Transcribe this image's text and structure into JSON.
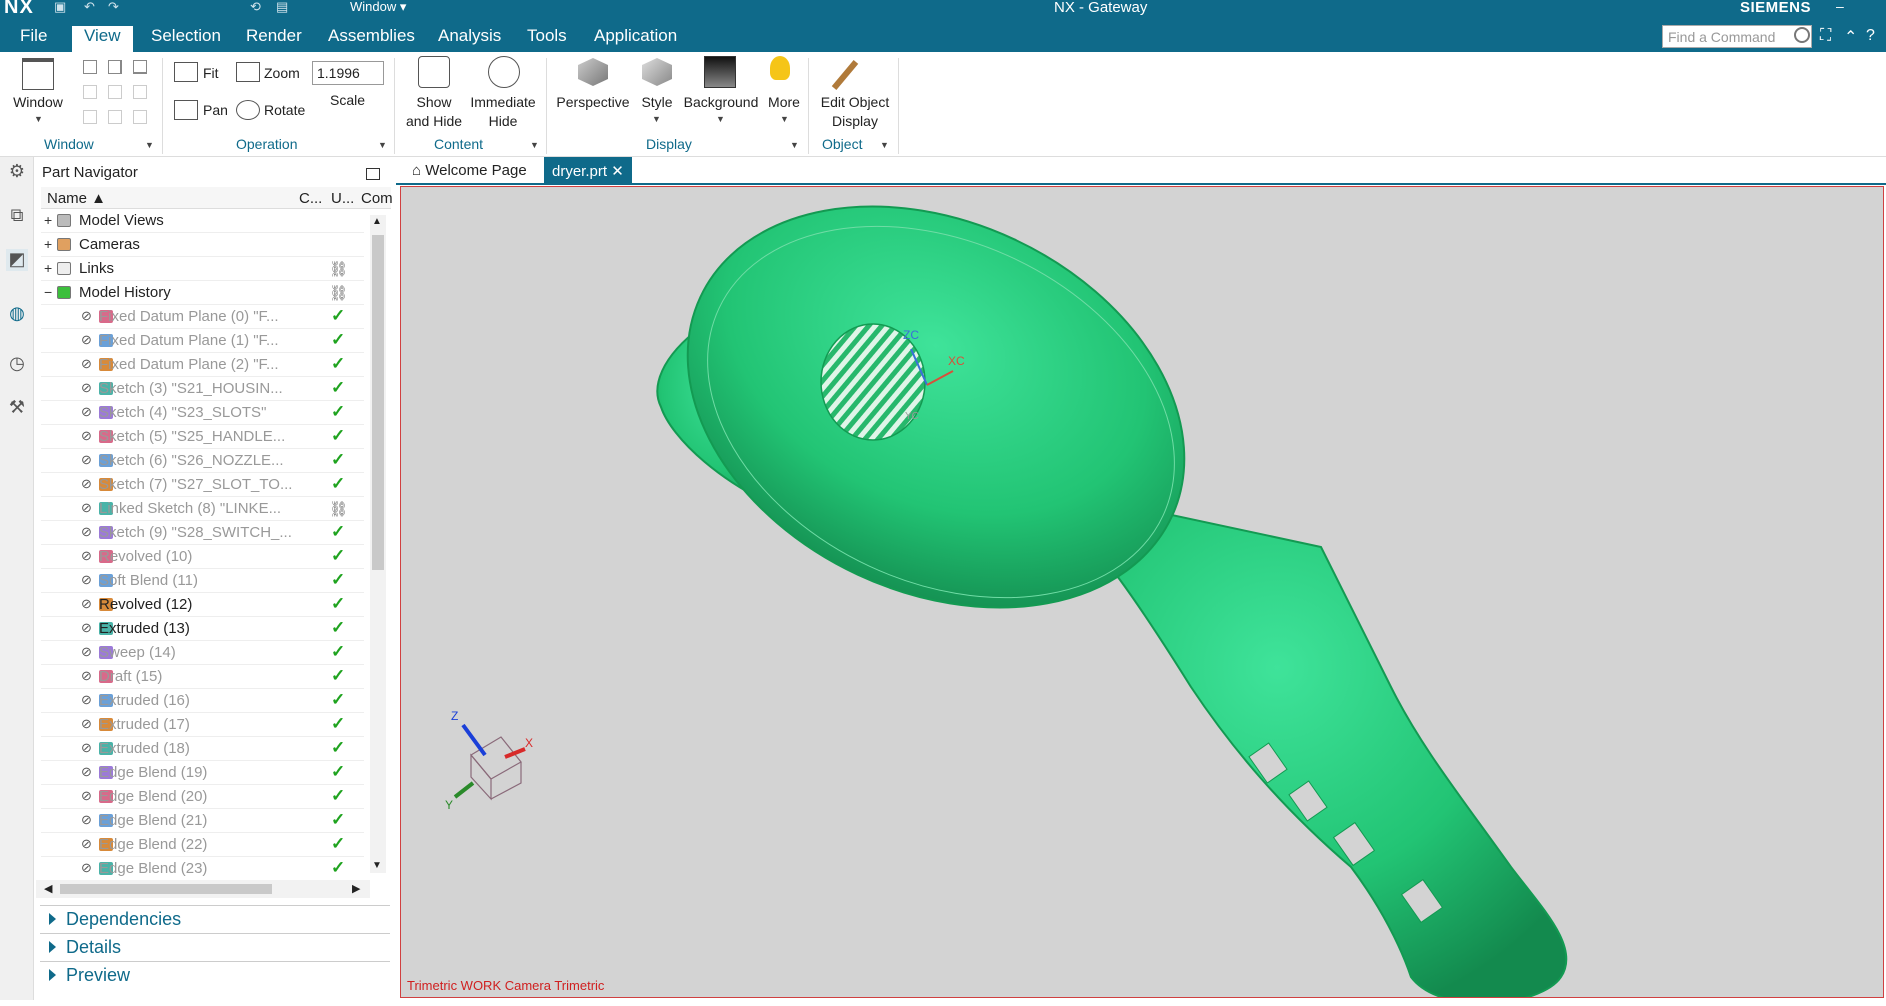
{
  "titlebar": {
    "logo": "NX",
    "window_menu": "Window",
    "title": "NX - Gateway",
    "brand": "SIEMENS"
  },
  "menubar": {
    "items": [
      "File",
      "View",
      "Selection",
      "Render",
      "Assemblies",
      "Analysis",
      "Tools",
      "Application"
    ],
    "active": "View",
    "search_placeholder": "Find a Command"
  },
  "ribbon": {
    "window_group": {
      "button": "Window",
      "label": "Window"
    },
    "operation_group": {
      "fit": "Fit",
      "zoom": "Zoom",
      "pan": "Pan",
      "rotate": "Rotate",
      "scale_value": "1.1996",
      "scale_label": "Scale",
      "label": "Operation"
    },
    "content_group": {
      "show_hide_1": "Show",
      "show_hide_2": "and Hide",
      "immediate_hide_1": "Immediate",
      "immediate_hide_2": "Hide",
      "label": "Content"
    },
    "display_group": {
      "perspective": "Perspective",
      "style": "Style",
      "background": "Background",
      "more": "More",
      "label": "Display"
    },
    "object_group": {
      "edit_1": "Edit Object",
      "edit_2": "Display",
      "label": "Object"
    }
  },
  "navigator": {
    "title": "Part Navigator",
    "columns": {
      "name": "Name",
      "c": "C...",
      "u": "U...",
      "com": "Com"
    },
    "rows": [
      {
        "label": "Model Views",
        "indent": 0,
        "dim": false,
        "status": "",
        "expand": "+"
      },
      {
        "label": "Cameras",
        "indent": 0,
        "dim": false,
        "status": "",
        "expand": "+"
      },
      {
        "label": "Links",
        "indent": 0,
        "dim": false,
        "status": "link",
        "expand": "+"
      },
      {
        "label": "Model History",
        "indent": 0,
        "dim": false,
        "status": "link",
        "expand": "−"
      },
      {
        "label": "Fixed Datum Plane (0) \"F...",
        "indent": 1,
        "dim": true,
        "status": "check"
      },
      {
        "label": "Fixed Datum Plane (1) \"F...",
        "indent": 1,
        "dim": true,
        "status": "check"
      },
      {
        "label": "Fixed Datum Plane (2) \"F...",
        "indent": 1,
        "dim": true,
        "status": "check"
      },
      {
        "label": "Sketch (3) \"S21_HOUSIN...",
        "indent": 1,
        "dim": true,
        "status": "check"
      },
      {
        "label": "Sketch (4) \"S23_SLOTS\"",
        "indent": 1,
        "dim": true,
        "status": "check"
      },
      {
        "label": "Sketch (5) \"S25_HANDLE...",
        "indent": 1,
        "dim": true,
        "status": "check"
      },
      {
        "label": "Sketch (6) \"S26_NOZZLE...",
        "indent": 1,
        "dim": true,
        "status": "check"
      },
      {
        "label": "Sketch (7) \"S27_SLOT_TO...",
        "indent": 1,
        "dim": true,
        "status": "check"
      },
      {
        "label": "Linked Sketch (8) \"LINKE...",
        "indent": 1,
        "dim": true,
        "status": "link"
      },
      {
        "label": "Sketch (9) \"S28_SWITCH_...",
        "indent": 1,
        "dim": true,
        "status": "check"
      },
      {
        "label": "Revolved (10)",
        "indent": 1,
        "dim": true,
        "status": "check"
      },
      {
        "label": "Soft Blend (11)",
        "indent": 1,
        "dim": true,
        "status": "check"
      },
      {
        "label": "Revolved (12)",
        "indent": 1,
        "dim": false,
        "status": "check"
      },
      {
        "label": "Extruded (13)",
        "indent": 1,
        "dim": false,
        "status": "check"
      },
      {
        "label": "Sweep (14)",
        "indent": 1,
        "dim": true,
        "status": "check"
      },
      {
        "label": "Draft (15)",
        "indent": 1,
        "dim": true,
        "status": "check"
      },
      {
        "label": "Extruded (16)",
        "indent": 1,
        "dim": true,
        "status": "check"
      },
      {
        "label": "Extruded (17)",
        "indent": 1,
        "dim": true,
        "status": "check"
      },
      {
        "label": "Extruded (18)",
        "indent": 1,
        "dim": true,
        "status": "check"
      },
      {
        "label": "Edge Blend (19)",
        "indent": 1,
        "dim": true,
        "status": "check"
      },
      {
        "label": "Edge Blend (20)",
        "indent": 1,
        "dim": true,
        "status": "check"
      },
      {
        "label": "Edge Blend (21)",
        "indent": 1,
        "dim": true,
        "status": "check"
      },
      {
        "label": "Edge Blend (22)",
        "indent": 1,
        "dim": true,
        "status": "check"
      },
      {
        "label": "Edge Blend (23)",
        "indent": 1,
        "dim": true,
        "status": "check"
      }
    ],
    "sections": [
      "Dependencies",
      "Details",
      "Preview"
    ]
  },
  "tabs": [
    {
      "label": "Welcome Page",
      "active": false
    },
    {
      "label": "dryer.prt",
      "active": true
    }
  ],
  "viewport": {
    "camera_label": "Trimetric WORK Camera Trimetric",
    "wcs": {
      "zc": "ZC",
      "xc": "XC",
      "yc": "YC"
    },
    "triad": {
      "z": "Z",
      "x": "X",
      "y": "Y"
    },
    "model_color": "#2ecc71"
  },
  "colors": {
    "accent": "#0f6a8a",
    "check": "#1fa31f",
    "viewport_bg": "#d3d3d3"
  }
}
